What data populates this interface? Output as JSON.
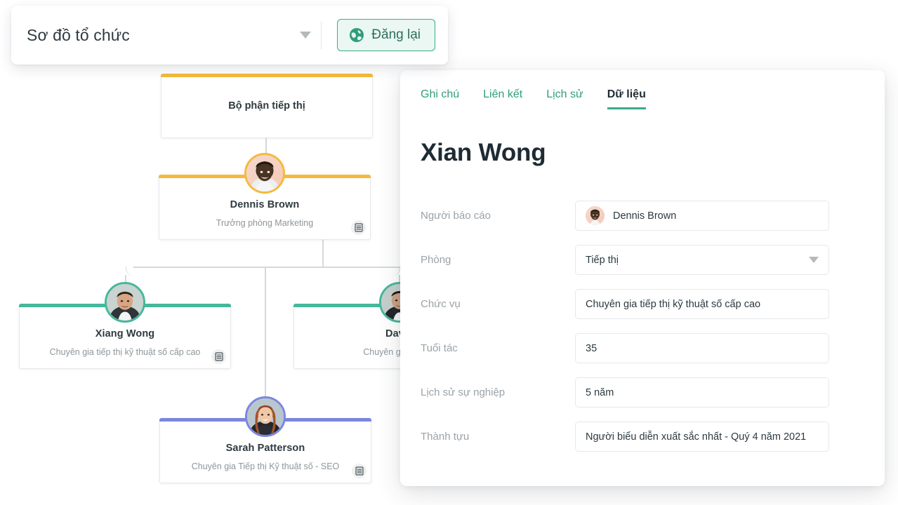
{
  "toolbar": {
    "chart_name": "Sơ đồ tổ chức",
    "caret_icon": "chevron-down-icon",
    "republish_label": "Đăng lại",
    "republish_icon": "globe-icon"
  },
  "chart": {
    "nodes": [
      {
        "id": "department",
        "kind": "department",
        "title": "Bộ phận tiếp thị",
        "accent": "#f6b93b",
        "has_db_badge": false
      },
      {
        "id": "dennis",
        "kind": "person",
        "title": "Dennis Brown",
        "subtitle": "Trưởng phòng Marketing",
        "accent": "#f6b93b",
        "avatar": "avatar-dennis",
        "has_db_badge": true
      },
      {
        "id": "xiang",
        "kind": "person",
        "title": "Xiang Wong",
        "subtitle": "Chuyên gia tiếp thị kỹ thuật số cấp cao",
        "accent": "#46b79a",
        "avatar": "avatar-xiang",
        "has_db_badge": true
      },
      {
        "id": "david",
        "kind": "person",
        "title": "David",
        "subtitle": "Chuyên gia tiếp thị",
        "accent": "#46b79a",
        "avatar": "avatar-david",
        "has_db_badge": false
      },
      {
        "id": "sarah",
        "kind": "person",
        "title": "Sarah Patterson",
        "subtitle": "Chuyên gia Tiếp thị Kỹ thuật số - SEO",
        "accent": "#7b86e0",
        "avatar": "avatar-sarah",
        "has_db_badge": true
      }
    ],
    "db_badge_icon": "database-icon"
  },
  "panel": {
    "tabs": [
      {
        "label": "Ghi chú",
        "active": false
      },
      {
        "label": "Liên kết",
        "active": false
      },
      {
        "label": "Lịch sử",
        "active": false
      },
      {
        "label": "Dữ liệu",
        "active": true
      }
    ],
    "person_name": "Xian Wong",
    "fields": [
      {
        "label": "Người báo cáo",
        "value": "Dennis Brown",
        "type": "avatar-text",
        "avatar": "avatar-dennis"
      },
      {
        "label": "Phòng",
        "value": "Tiếp thị",
        "type": "select",
        "caret_icon": "chevron-down-icon"
      },
      {
        "label": "Chức vụ",
        "value": "Chuyên gia tiếp thị kỹ thuật số cấp cao",
        "type": "text"
      },
      {
        "label": "Tuổi tác",
        "value": "35",
        "type": "text"
      },
      {
        "label": "Lịch sử sự nghiệp",
        "value": "5 năm",
        "type": "text"
      },
      {
        "label": "Thành tựu",
        "value": "Người biểu diễn xuất sắc nhất - Quý 4 năm 2021",
        "type": "text"
      }
    ]
  },
  "colors": {
    "accent_teal": "#3aab8a",
    "accent_amber": "#f6b93b",
    "accent_periwinkle": "#7b86e0",
    "text_dark": "#1e2b33",
    "text_muted": "#9aa2a7"
  }
}
